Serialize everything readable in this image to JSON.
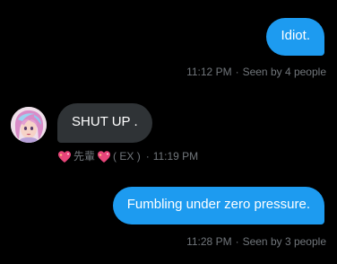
{
  "messages": [
    {
      "direction": "sent",
      "text": "Idiot.",
      "time": "11:12 PM",
      "separator": "·",
      "seen": "Seen by 4 people"
    },
    {
      "direction": "received",
      "text": "SHUT UP .",
      "sender_name_part1": "先輩",
      "sender_name_part2": "( EX )",
      "separator": "·",
      "time": "11:19 PM",
      "sender_emoji": "sparkling-heart-icon"
    },
    {
      "direction": "sent",
      "text": "Fumbling under zero pressure.",
      "time": "11:28 PM",
      "separator": "·",
      "seen": "Seen by 3 people"
    }
  ],
  "colors": {
    "background": "#000000",
    "sent_bubble": "#1d9bf0",
    "received_bubble": "#2f3336",
    "meta_text": "#71767b",
    "heart": "#e8457a"
  }
}
